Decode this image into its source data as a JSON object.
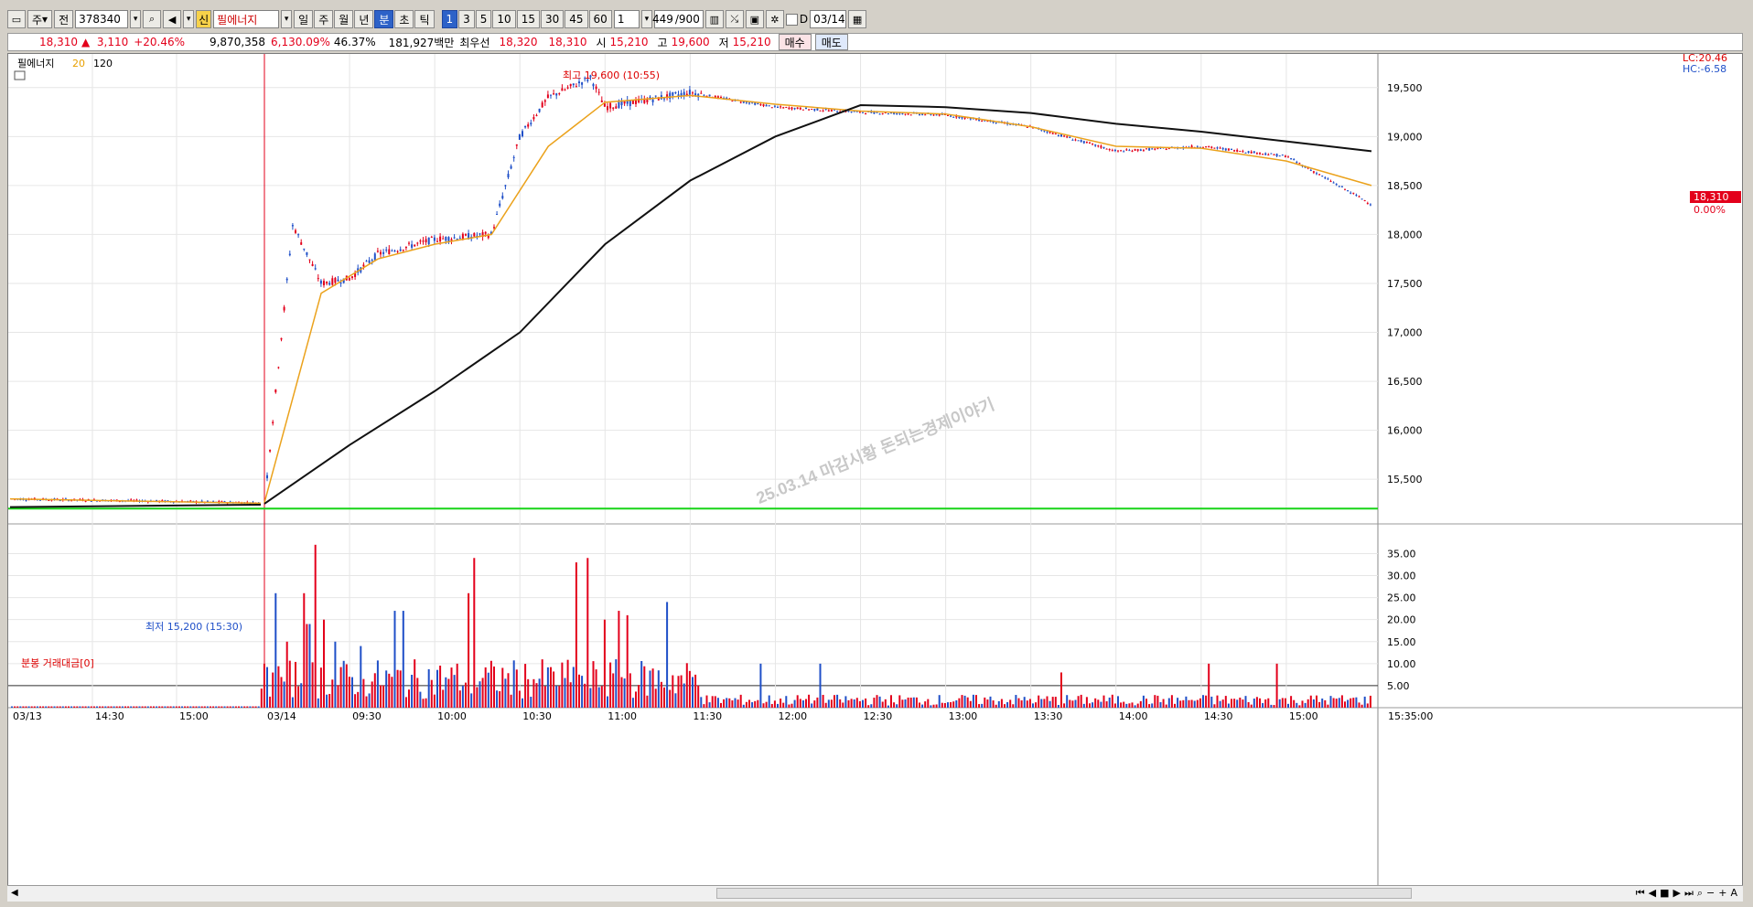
{
  "toolbar": {
    "market": "주",
    "prev": "전",
    "code": "378340",
    "badge": "신",
    "name": "필에너지",
    "periods": [
      "일",
      "주",
      "월",
      "년",
      "분",
      "초",
      "틱"
    ],
    "active_period": "분",
    "intervals": [
      "1",
      "3",
      "5",
      "10",
      "15",
      "30",
      "45",
      "60"
    ],
    "active_interval": "1",
    "custom_interval": "1",
    "count": "449",
    "count_max": "/900",
    "d_label": "D",
    "date": "03/14"
  },
  "quote": {
    "price": "18,310",
    "change": "3,110",
    "change_pct": "+20.46%",
    "volume": "9,870,358",
    "volume_pct": "6,130.09%",
    "turnover_pct": "46.37%",
    "value": "181,927백만",
    "best_label": "최우선",
    "ask": "18,320",
    "bid": "18,310",
    "open_label": "시",
    "open": "15,210",
    "high_label": "고",
    "high": "19,600",
    "low_label": "저",
    "low": "15,210",
    "buy_label": "매수",
    "sell_label": "매도"
  },
  "price_panel": {
    "legend_name": "필에너지",
    "ma_short": "20",
    "ma_long": "120",
    "lc_label": "LC:20.46",
    "hc_label": "HC:-6.58",
    "high_annot": "최고 19,600 (10:55)",
    "low_annot": "최저 15,200 (15:30)",
    "current_price": "18,310",
    "current_pct": "0.00%",
    "watermark": "25.03.14 마감시황 돈되는경제이야기"
  },
  "volume_panel": {
    "title": "분봉 거래대금[0]"
  },
  "time_axis": {
    "labels": [
      "03/13",
      "14:30",
      "15:00",
      "03/14",
      "09:30",
      "10:00",
      "10:30",
      "11:00",
      "11:30",
      "12:00",
      "12:30",
      "13:00",
      "13:30",
      "14:00",
      "14:30",
      "15:00",
      "15:35:00"
    ]
  },
  "chart_data": {
    "type": "candlestick",
    "price_axis_ticks": [
      "15,500",
      "16,000",
      "16,500",
      "17,000",
      "17,500",
      "18,000",
      "18,500",
      "19,000",
      "19,500"
    ],
    "price_range": [
      15100,
      19750
    ],
    "volume_axis_ticks": [
      "5.00",
      "10.00",
      "15.00",
      "20.00",
      "25.00",
      "30.00",
      "35.00"
    ],
    "volume_range": [
      0,
      38
    ],
    "reference_line": 15200,
    "series": [
      {
        "name": "필에너지",
        "x": [
          "03/13 14:00",
          "03/13 15:30",
          "03/14 09:00",
          "09:10",
          "09:20",
          "09:30",
          "09:40",
          "10:00",
          "10:20",
          "10:30",
          "10:40",
          "10:55",
          "11:00",
          "11:30",
          "12:00",
          "12:30",
          "13:00",
          "13:30",
          "14:00",
          "14:30",
          "15:00",
          "15:30"
        ],
        "values": [
          15300,
          15260,
          15260,
          18100,
          17500,
          17550,
          17800,
          17950,
          18000,
          19000,
          19400,
          19600,
          19300,
          19450,
          19300,
          19250,
          19220,
          19100,
          18850,
          18900,
          18800,
          18310
        ]
      },
      {
        "name": "20",
        "x": [
          "03/14 09:00",
          "09:20",
          "09:40",
          "10:00",
          "10:20",
          "10:40",
          "11:00",
          "11:30",
          "12:00",
          "12:30",
          "13:00",
          "13:30",
          "14:00",
          "14:30",
          "15:00",
          "15:30"
        ],
        "values": [
          15260,
          17400,
          17750,
          17900,
          18000,
          18900,
          19350,
          19420,
          19330,
          19260,
          19230,
          19100,
          18900,
          18880,
          18750,
          18500
        ]
      },
      {
        "name": "120",
        "x": [
          "03/14 09:00",
          "09:30",
          "10:00",
          "10:30",
          "11:00",
          "11:30",
          "12:00",
          "12:30",
          "13:00",
          "13:30",
          "14:00",
          "14:30",
          "15:00",
          "15:30"
        ],
        "values": [
          15250,
          15850,
          16400,
          17000,
          17900,
          18550,
          19000,
          19320,
          19300,
          19240,
          19130,
          19050,
          18950,
          18850
        ]
      }
    ]
  }
}
